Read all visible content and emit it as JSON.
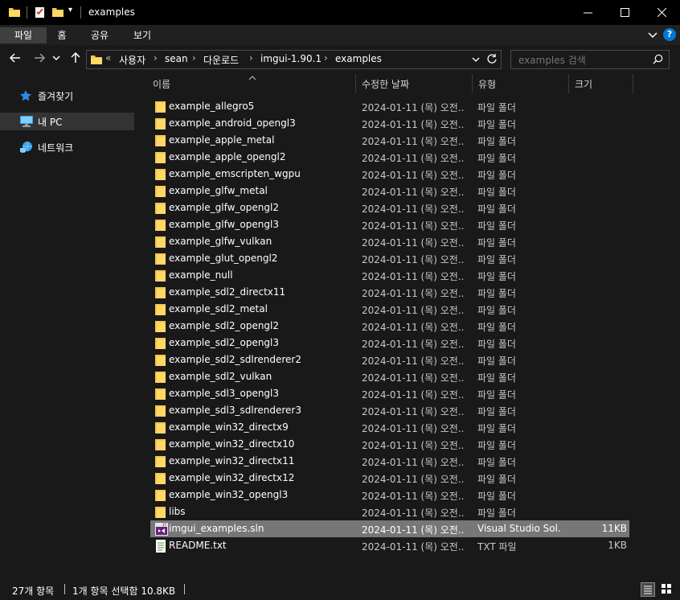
{
  "window": {
    "title": "examples",
    "buttons": {
      "minimize": "—",
      "maximize": "☐",
      "close": "✕"
    }
  },
  "ribbon": {
    "tabs": [
      {
        "label": "파일",
        "active": true
      },
      {
        "label": "홈",
        "active": false
      },
      {
        "label": "공유",
        "active": false
      },
      {
        "label": "보기",
        "active": false
      }
    ],
    "help": "?"
  },
  "address": {
    "overflow": "«",
    "crumbs": [
      "사용자",
      "sean",
      "다운로드",
      "imgui-1.90.1",
      "examples"
    ],
    "separator": "›"
  },
  "search": {
    "placeholder": "examples 검색"
  },
  "sidebar": {
    "items": [
      {
        "label": "즐겨찾기",
        "icon": "star-icon"
      },
      {
        "label": "내 PC",
        "icon": "pc-icon",
        "selected": true
      },
      {
        "label": "네트워크",
        "icon": "network-icon"
      }
    ]
  },
  "columns": {
    "name": "이름",
    "date": "수정한 날짜",
    "type": "유형",
    "size": "크기"
  },
  "files": [
    {
      "name": "example_allegro5",
      "date": "2024-01-11 (목) 오전...",
      "type": "파일 폴더",
      "size": "",
      "icon": "folder-icon"
    },
    {
      "name": "example_android_opengl3",
      "date": "2024-01-11 (목) 오전...",
      "type": "파일 폴더",
      "size": "",
      "icon": "folder-icon"
    },
    {
      "name": "example_apple_metal",
      "date": "2024-01-11 (목) 오전...",
      "type": "파일 폴더",
      "size": "",
      "icon": "folder-icon"
    },
    {
      "name": "example_apple_opengl2",
      "date": "2024-01-11 (목) 오전...",
      "type": "파일 폴더",
      "size": "",
      "icon": "folder-icon"
    },
    {
      "name": "example_emscripten_wgpu",
      "date": "2024-01-11 (목) 오전...",
      "type": "파일 폴더",
      "size": "",
      "icon": "folder-icon"
    },
    {
      "name": "example_glfw_metal",
      "date": "2024-01-11 (목) 오전...",
      "type": "파일 폴더",
      "size": "",
      "icon": "folder-icon"
    },
    {
      "name": "example_glfw_opengl2",
      "date": "2024-01-11 (목) 오전...",
      "type": "파일 폴더",
      "size": "",
      "icon": "folder-icon"
    },
    {
      "name": "example_glfw_opengl3",
      "date": "2024-01-11 (목) 오전...",
      "type": "파일 폴더",
      "size": "",
      "icon": "folder-icon"
    },
    {
      "name": "example_glfw_vulkan",
      "date": "2024-01-11 (목) 오전...",
      "type": "파일 폴더",
      "size": "",
      "icon": "folder-icon"
    },
    {
      "name": "example_glut_opengl2",
      "date": "2024-01-11 (목) 오전...",
      "type": "파일 폴더",
      "size": "",
      "icon": "folder-icon"
    },
    {
      "name": "example_null",
      "date": "2024-01-11 (목) 오전...",
      "type": "파일 폴더",
      "size": "",
      "icon": "folder-icon"
    },
    {
      "name": "example_sdl2_directx11",
      "date": "2024-01-11 (목) 오전...",
      "type": "파일 폴더",
      "size": "",
      "icon": "folder-icon"
    },
    {
      "name": "example_sdl2_metal",
      "date": "2024-01-11 (목) 오전...",
      "type": "파일 폴더",
      "size": "",
      "icon": "folder-icon"
    },
    {
      "name": "example_sdl2_opengl2",
      "date": "2024-01-11 (목) 오전...",
      "type": "파일 폴더",
      "size": "",
      "icon": "folder-icon"
    },
    {
      "name": "example_sdl2_opengl3",
      "date": "2024-01-11 (목) 오전...",
      "type": "파일 폴더",
      "size": "",
      "icon": "folder-icon"
    },
    {
      "name": "example_sdl2_sdlrenderer2",
      "date": "2024-01-11 (목) 오전...",
      "type": "파일 폴더",
      "size": "",
      "icon": "folder-icon"
    },
    {
      "name": "example_sdl2_vulkan",
      "date": "2024-01-11 (목) 오전...",
      "type": "파일 폴더",
      "size": "",
      "icon": "folder-icon"
    },
    {
      "name": "example_sdl3_opengl3",
      "date": "2024-01-11 (목) 오전...",
      "type": "파일 폴더",
      "size": "",
      "icon": "folder-icon"
    },
    {
      "name": "example_sdl3_sdlrenderer3",
      "date": "2024-01-11 (목) 오전...",
      "type": "파일 폴더",
      "size": "",
      "icon": "folder-icon"
    },
    {
      "name": "example_win32_directx9",
      "date": "2024-01-11 (목) 오전...",
      "type": "파일 폴더",
      "size": "",
      "icon": "folder-icon"
    },
    {
      "name": "example_win32_directx10",
      "date": "2024-01-11 (목) 오전...",
      "type": "파일 폴더",
      "size": "",
      "icon": "folder-icon"
    },
    {
      "name": "example_win32_directx11",
      "date": "2024-01-11 (목) 오전...",
      "type": "파일 폴더",
      "size": "",
      "icon": "folder-icon"
    },
    {
      "name": "example_win32_directx12",
      "date": "2024-01-11 (목) 오전...",
      "type": "파일 폴더",
      "size": "",
      "icon": "folder-icon"
    },
    {
      "name": "example_win32_opengl3",
      "date": "2024-01-11 (목) 오전...",
      "type": "파일 폴더",
      "size": "",
      "icon": "folder-icon"
    },
    {
      "name": "libs",
      "date": "2024-01-11 (목) 오전...",
      "type": "파일 폴더",
      "size": "",
      "icon": "folder-icon"
    },
    {
      "name": "imgui_examples.sln",
      "date": "2024-01-11 (목) 오전...",
      "type": "Visual Studio Sol...",
      "size": "11KB",
      "icon": "vs-solution-icon",
      "selected": true
    },
    {
      "name": "README.txt",
      "date": "2024-01-11 (목) 오전...",
      "type": "TXT 파일",
      "size": "1KB",
      "icon": "text-file-icon"
    }
  ],
  "status": {
    "count": "27개 항목",
    "selection": "1개 항목 선택함 10.8KB"
  },
  "colors": {
    "background": "#191919",
    "titlebar": "#000000",
    "selected_row": "#777777",
    "folder": "#f3c74e",
    "accent": "#0078d7"
  }
}
